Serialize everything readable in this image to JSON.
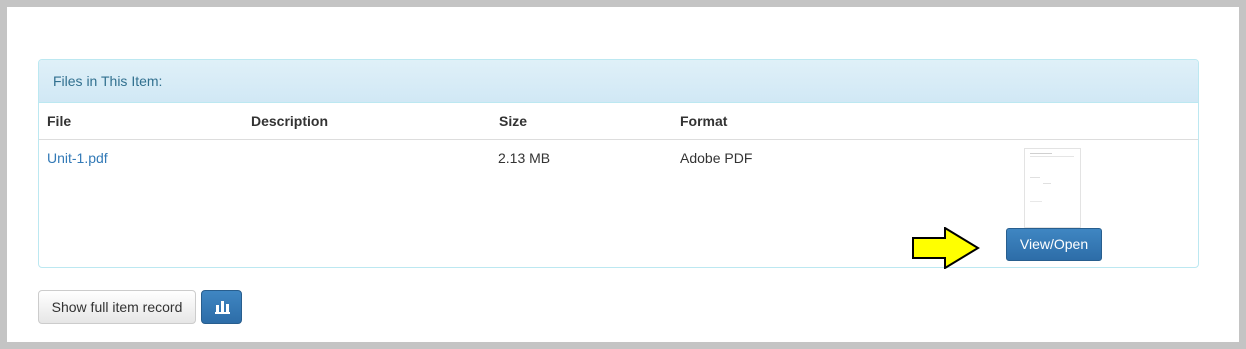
{
  "panel": {
    "heading": "Files in This Item:",
    "columns": {
      "file": "File",
      "description": "Description",
      "size": "Size",
      "format": "Format"
    },
    "rows": [
      {
        "file": "Unit-1.pdf",
        "description": "",
        "size": "2.13 MB",
        "format": "Adobe PDF",
        "action_label": "View/Open"
      }
    ]
  },
  "footer": {
    "show_record_label": "Show full item record",
    "stats_icon": "bar-chart-icon"
  },
  "annotation": {
    "arrow_icon": "right-arrow-icon",
    "arrow_color": "#ffff00"
  },
  "colors": {
    "primary": "#337ab7",
    "panel_border": "#bce8f1",
    "panel_heading_text": "#31708f"
  }
}
